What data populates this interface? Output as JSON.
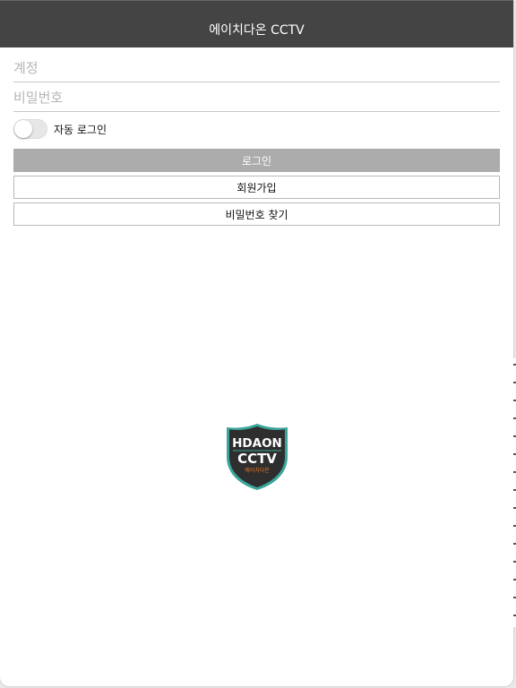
{
  "header": {
    "title": "에이치다온 CCTV"
  },
  "login_form": {
    "account_placeholder": "계정",
    "password_placeholder": "비밀번호",
    "auto_login_label": "자동 로그인",
    "auto_login_on": false,
    "login_button": "로그인",
    "signup_button": "회원가입",
    "find_password_button": "비밀번호 찾기"
  },
  "logo": {
    "line1": "HDAON",
    "line2": "CCTV",
    "line3": "에이치다온"
  },
  "colors": {
    "header_bg": "#444444",
    "login_button_bg": "#acacac",
    "logo_teal": "#3aa59a",
    "logo_orange": "#e8782e"
  }
}
